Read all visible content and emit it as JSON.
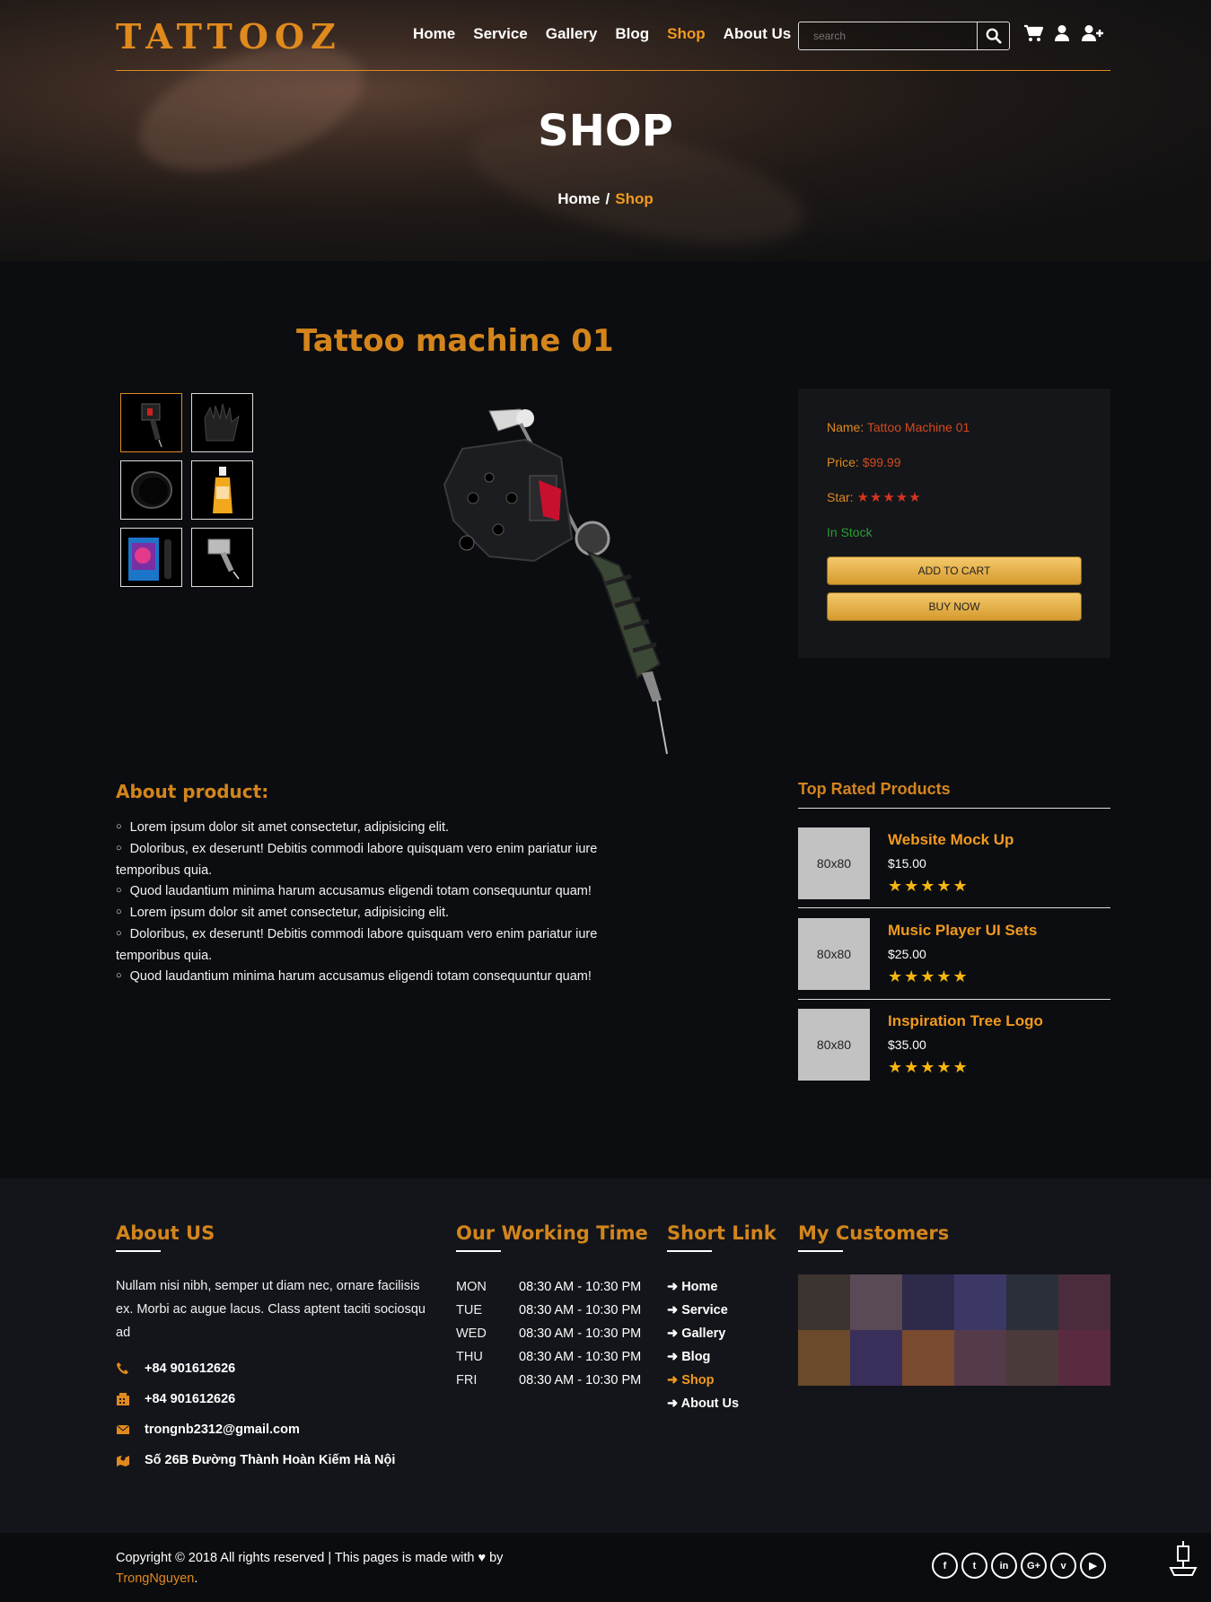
{
  "brand": {
    "logo_text": "TATTOOZ",
    "accent": "#e08a1e"
  },
  "nav": [
    {
      "label": "Home",
      "active": false
    },
    {
      "label": "Service",
      "active": false
    },
    {
      "label": "Gallery",
      "active": false
    },
    {
      "label": "Blog",
      "active": false
    },
    {
      "label": "Shop",
      "active": true
    },
    {
      "label": "About Us",
      "active": false
    }
  ],
  "search": {
    "placeholder": "search",
    "icon": "search-icon"
  },
  "header_icons": [
    "cart-icon",
    "user-icon",
    "user-plus-icon"
  ],
  "hero": {
    "title": "SHOP",
    "breadcrumb": [
      "Home",
      "Shop"
    ],
    "separator": "/"
  },
  "product": {
    "title": "Tattoo machine 01",
    "thumbnails": [
      "tattoo-machine",
      "black-gloves",
      "black-cup",
      "ink-bottle",
      "ink-box",
      "machine-silver"
    ],
    "selected_thumbnail": 0,
    "info": {
      "name_label": "Name:",
      "name_value": "Tattoo Machine 01",
      "price_label": "Price:",
      "price_value": "$99.99",
      "star_label": "Star:",
      "stars": 5,
      "stock": "In Stock",
      "add_to_cart": "ADD TO CART",
      "buy_now": "BUY NOW"
    }
  },
  "about": {
    "heading": "About product:",
    "items": [
      "Lorem ipsum dolor sit amet consectetur, adipisicing elit.",
      "Doloribus, ex deserunt! Debitis commodi labore quisquam vero enim pariatur iure temporibus quia.",
      "Quod laudantium minima harum accusamus eligendi totam consequuntur quam!",
      "Lorem ipsum dolor sit amet consectetur, adipisicing elit.",
      "Doloribus, ex deserunt! Debitis commodi labore quisquam vero enim pariatur iure temporibus quia.",
      "Quod laudantium minima harum accusamus eligendi totam consequuntur quam!"
    ]
  },
  "top_rated": {
    "heading": "Top Rated Products",
    "items": [
      {
        "placeholder": "80x80",
        "name": "Website Mock Up",
        "price": "$15.00",
        "stars": 5
      },
      {
        "placeholder": "80x80",
        "name": "Music Player UI Sets",
        "price": "$25.00",
        "stars": 5
      },
      {
        "placeholder": "80x80",
        "name": "Inspiration Tree Logo",
        "price": "$35.00",
        "stars": 5
      }
    ]
  },
  "footer": {
    "about_heading": "About US",
    "about_text": "Nullam nisi nibh, semper ut diam nec, ornare facilisis ex. Morbi ac augue lacus. Class aptent taciti sociosqu ad",
    "contacts": [
      {
        "icon": "phone-icon",
        "text": "+84 901612626"
      },
      {
        "icon": "fax-icon",
        "text": "+84 901612626"
      },
      {
        "icon": "envelope-icon",
        "text": "trongnb2312@gmail.com"
      },
      {
        "icon": "map-icon",
        "text": "Số 26B Đường Thành Hoàn Kiếm Hà Nội"
      }
    ],
    "working_heading": "Our Working Time",
    "working": [
      {
        "day": "MON",
        "time": "08:30 AM - 10:30 PM"
      },
      {
        "day": "TUE",
        "time": "08:30 AM - 10:30 PM"
      },
      {
        "day": "WED",
        "time": "08:30 AM - 10:30 PM"
      },
      {
        "day": "THU",
        "time": "08:30 AM - 10:30 PM"
      },
      {
        "day": "FRI",
        "time": "08:30 AM - 10:30 PM"
      }
    ],
    "links_heading": "Short Link",
    "links": [
      {
        "label": "Home",
        "active": false
      },
      {
        "label": "Service",
        "active": false
      },
      {
        "label": "Gallery",
        "active": false
      },
      {
        "label": "Blog",
        "active": false
      },
      {
        "label": "Shop",
        "active": true
      },
      {
        "label": "About Us",
        "active": false
      }
    ],
    "customers_heading": "My Customers",
    "copyright_prefix": "Copyright © 2018 All rights reserved | This pages is made with",
    "copyright_by": "by",
    "author": "TrongNguyen",
    "author_suffix": ".",
    "social": [
      "facebook-icon",
      "twitter-icon",
      "linkedin-icon",
      "google-plus-icon",
      "vimeo-icon",
      "youtube-icon"
    ]
  }
}
